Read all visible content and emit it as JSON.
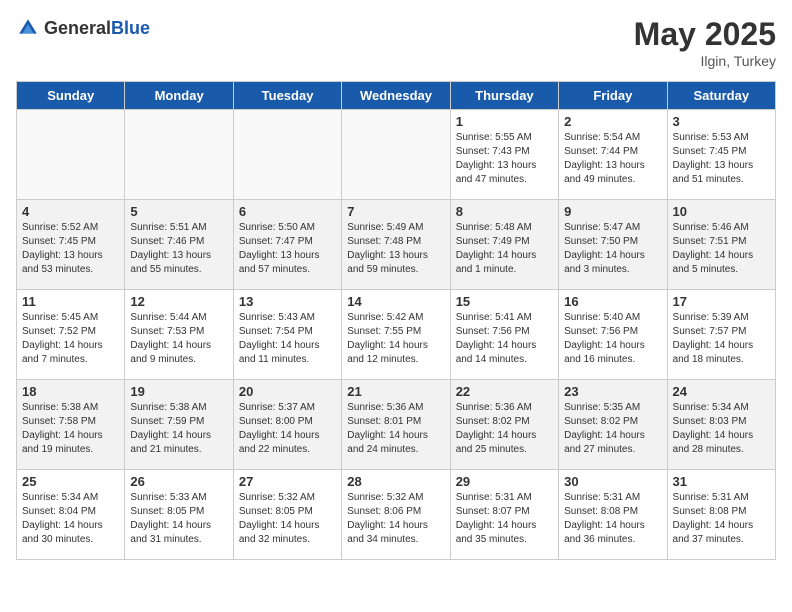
{
  "header": {
    "logo_general": "General",
    "logo_blue": "Blue",
    "title": "May 2025",
    "location": "Ilgin, Turkey"
  },
  "weekdays": [
    "Sunday",
    "Monday",
    "Tuesday",
    "Wednesday",
    "Thursday",
    "Friday",
    "Saturday"
  ],
  "weeks": [
    [
      {
        "day": "",
        "info": ""
      },
      {
        "day": "",
        "info": ""
      },
      {
        "day": "",
        "info": ""
      },
      {
        "day": "",
        "info": ""
      },
      {
        "day": "1",
        "info": "Sunrise: 5:55 AM\nSunset: 7:43 PM\nDaylight: 13 hours\nand 47 minutes."
      },
      {
        "day": "2",
        "info": "Sunrise: 5:54 AM\nSunset: 7:44 PM\nDaylight: 13 hours\nand 49 minutes."
      },
      {
        "day": "3",
        "info": "Sunrise: 5:53 AM\nSunset: 7:45 PM\nDaylight: 13 hours\nand 51 minutes."
      }
    ],
    [
      {
        "day": "4",
        "info": "Sunrise: 5:52 AM\nSunset: 7:45 PM\nDaylight: 13 hours\nand 53 minutes."
      },
      {
        "day": "5",
        "info": "Sunrise: 5:51 AM\nSunset: 7:46 PM\nDaylight: 13 hours\nand 55 minutes."
      },
      {
        "day": "6",
        "info": "Sunrise: 5:50 AM\nSunset: 7:47 PM\nDaylight: 13 hours\nand 57 minutes."
      },
      {
        "day": "7",
        "info": "Sunrise: 5:49 AM\nSunset: 7:48 PM\nDaylight: 13 hours\nand 59 minutes."
      },
      {
        "day": "8",
        "info": "Sunrise: 5:48 AM\nSunset: 7:49 PM\nDaylight: 14 hours\nand 1 minute."
      },
      {
        "day": "9",
        "info": "Sunrise: 5:47 AM\nSunset: 7:50 PM\nDaylight: 14 hours\nand 3 minutes."
      },
      {
        "day": "10",
        "info": "Sunrise: 5:46 AM\nSunset: 7:51 PM\nDaylight: 14 hours\nand 5 minutes."
      }
    ],
    [
      {
        "day": "11",
        "info": "Sunrise: 5:45 AM\nSunset: 7:52 PM\nDaylight: 14 hours\nand 7 minutes."
      },
      {
        "day": "12",
        "info": "Sunrise: 5:44 AM\nSunset: 7:53 PM\nDaylight: 14 hours\nand 9 minutes."
      },
      {
        "day": "13",
        "info": "Sunrise: 5:43 AM\nSunset: 7:54 PM\nDaylight: 14 hours\nand 11 minutes."
      },
      {
        "day": "14",
        "info": "Sunrise: 5:42 AM\nSunset: 7:55 PM\nDaylight: 14 hours\nand 12 minutes."
      },
      {
        "day": "15",
        "info": "Sunrise: 5:41 AM\nSunset: 7:56 PM\nDaylight: 14 hours\nand 14 minutes."
      },
      {
        "day": "16",
        "info": "Sunrise: 5:40 AM\nSunset: 7:56 PM\nDaylight: 14 hours\nand 16 minutes."
      },
      {
        "day": "17",
        "info": "Sunrise: 5:39 AM\nSunset: 7:57 PM\nDaylight: 14 hours\nand 18 minutes."
      }
    ],
    [
      {
        "day": "18",
        "info": "Sunrise: 5:38 AM\nSunset: 7:58 PM\nDaylight: 14 hours\nand 19 minutes."
      },
      {
        "day": "19",
        "info": "Sunrise: 5:38 AM\nSunset: 7:59 PM\nDaylight: 14 hours\nand 21 minutes."
      },
      {
        "day": "20",
        "info": "Sunrise: 5:37 AM\nSunset: 8:00 PM\nDaylight: 14 hours\nand 22 minutes."
      },
      {
        "day": "21",
        "info": "Sunrise: 5:36 AM\nSunset: 8:01 PM\nDaylight: 14 hours\nand 24 minutes."
      },
      {
        "day": "22",
        "info": "Sunrise: 5:36 AM\nSunset: 8:02 PM\nDaylight: 14 hours\nand 25 minutes."
      },
      {
        "day": "23",
        "info": "Sunrise: 5:35 AM\nSunset: 8:02 PM\nDaylight: 14 hours\nand 27 minutes."
      },
      {
        "day": "24",
        "info": "Sunrise: 5:34 AM\nSunset: 8:03 PM\nDaylight: 14 hours\nand 28 minutes."
      }
    ],
    [
      {
        "day": "25",
        "info": "Sunrise: 5:34 AM\nSunset: 8:04 PM\nDaylight: 14 hours\nand 30 minutes."
      },
      {
        "day": "26",
        "info": "Sunrise: 5:33 AM\nSunset: 8:05 PM\nDaylight: 14 hours\nand 31 minutes."
      },
      {
        "day": "27",
        "info": "Sunrise: 5:32 AM\nSunset: 8:05 PM\nDaylight: 14 hours\nand 32 minutes."
      },
      {
        "day": "28",
        "info": "Sunrise: 5:32 AM\nSunset: 8:06 PM\nDaylight: 14 hours\nand 34 minutes."
      },
      {
        "day": "29",
        "info": "Sunrise: 5:31 AM\nSunset: 8:07 PM\nDaylight: 14 hours\nand 35 minutes."
      },
      {
        "day": "30",
        "info": "Sunrise: 5:31 AM\nSunset: 8:08 PM\nDaylight: 14 hours\nand 36 minutes."
      },
      {
        "day": "31",
        "info": "Sunrise: 5:31 AM\nSunset: 8:08 PM\nDaylight: 14 hours\nand 37 minutes."
      }
    ]
  ]
}
